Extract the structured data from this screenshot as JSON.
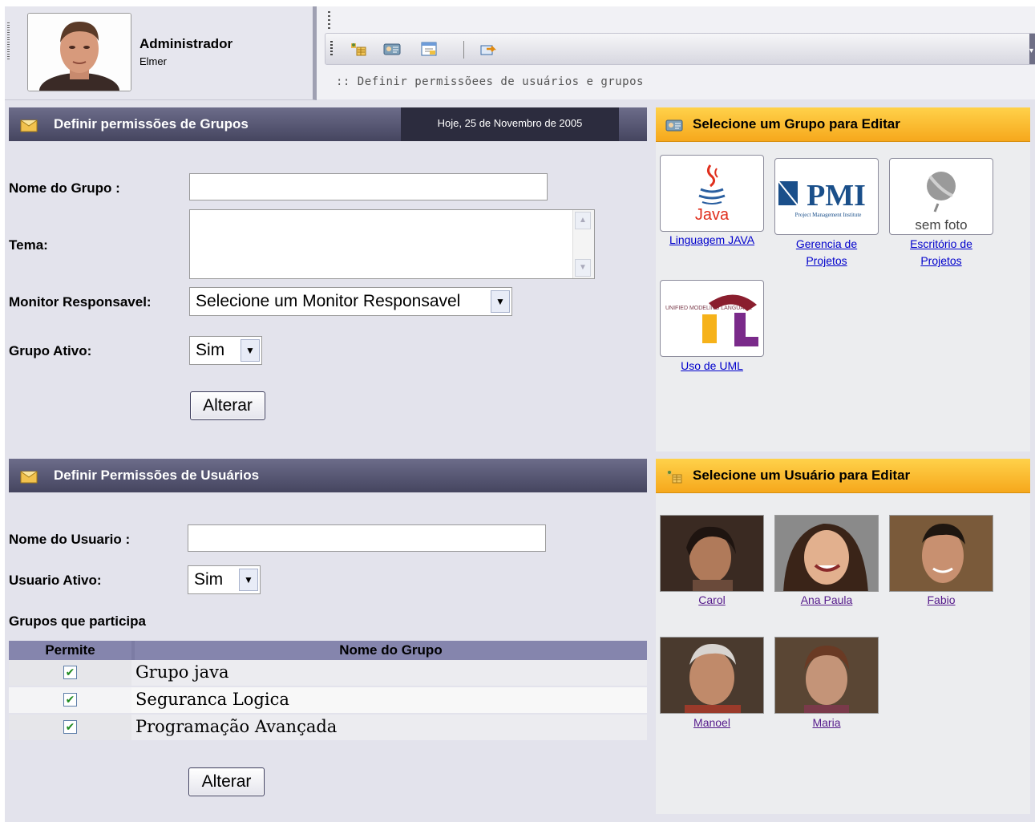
{
  "header": {
    "user_title": "Administrador",
    "user_name": "Elmer",
    "breadcrumb": ":: Definir permissõees de usuários e grupos",
    "toolbar_icons": [
      "group-icon",
      "user-card-icon",
      "window-icon",
      "logout-arrow-icon"
    ]
  },
  "groups_section": {
    "title": "Definir permissões de Grupos",
    "date": "Hoje, 25 de Novembro de 2005",
    "name_label": "Nome do Grupo :",
    "name_value": "",
    "theme_label": "Tema:",
    "theme_value": "",
    "monitor_label": "Monitor Responsavel:",
    "monitor_value": "Selecione um Monitor Responsavel",
    "active_label": "Grupo Ativo:",
    "active_value": "Sim",
    "submit_label": "Alterar"
  },
  "users_section": {
    "title": "Definir Permissões de Usuários",
    "name_label": "Nome do Usuario :",
    "name_value": "",
    "active_label": "Usuario Ativo:",
    "active_value": "Sim",
    "groups_label": "Grupos que participa",
    "table": {
      "col_allow": "Permite",
      "col_group": "Nome do Grupo",
      "rows": [
        {
          "allowed": true,
          "group": "Grupo java"
        },
        {
          "allowed": true,
          "group": "Seguranca Logica"
        },
        {
          "allowed": true,
          "group": "Programação Avançada"
        }
      ]
    },
    "submit_label": "Alterar"
  },
  "group_picker": {
    "title": "Selecione um Grupo para Editar",
    "items": [
      {
        "line1": "Linguagem JAVA",
        "line2": "",
        "logo_text": "Java"
      },
      {
        "line1": "Gerencia de",
        "line2": "Projetos",
        "logo_text": "PMI",
        "logo_sub": "Project Management Institute"
      },
      {
        "line1": "Escritório de",
        "line2": "Projetos",
        "logo_text": "sem foto"
      },
      {
        "line1": "Uso de UML",
        "line2": "",
        "logo_text": "UML",
        "logo_sub": "UNIFIED MODELING LANGUAGE"
      }
    ]
  },
  "user_picker": {
    "title": "Selecione um Usuário para Editar",
    "items": [
      {
        "name": "Carol"
      },
      {
        "name": "Ana Paula"
      },
      {
        "name": "Fabio"
      },
      {
        "name": "Manoel"
      },
      {
        "name": "Maria"
      }
    ]
  },
  "colors": {
    "section_header": "#45455f",
    "picker_header": "#f6a81c",
    "panel_bg": "#e3e3ec",
    "link": "#0000cc",
    "visited_link": "#551a8b"
  }
}
